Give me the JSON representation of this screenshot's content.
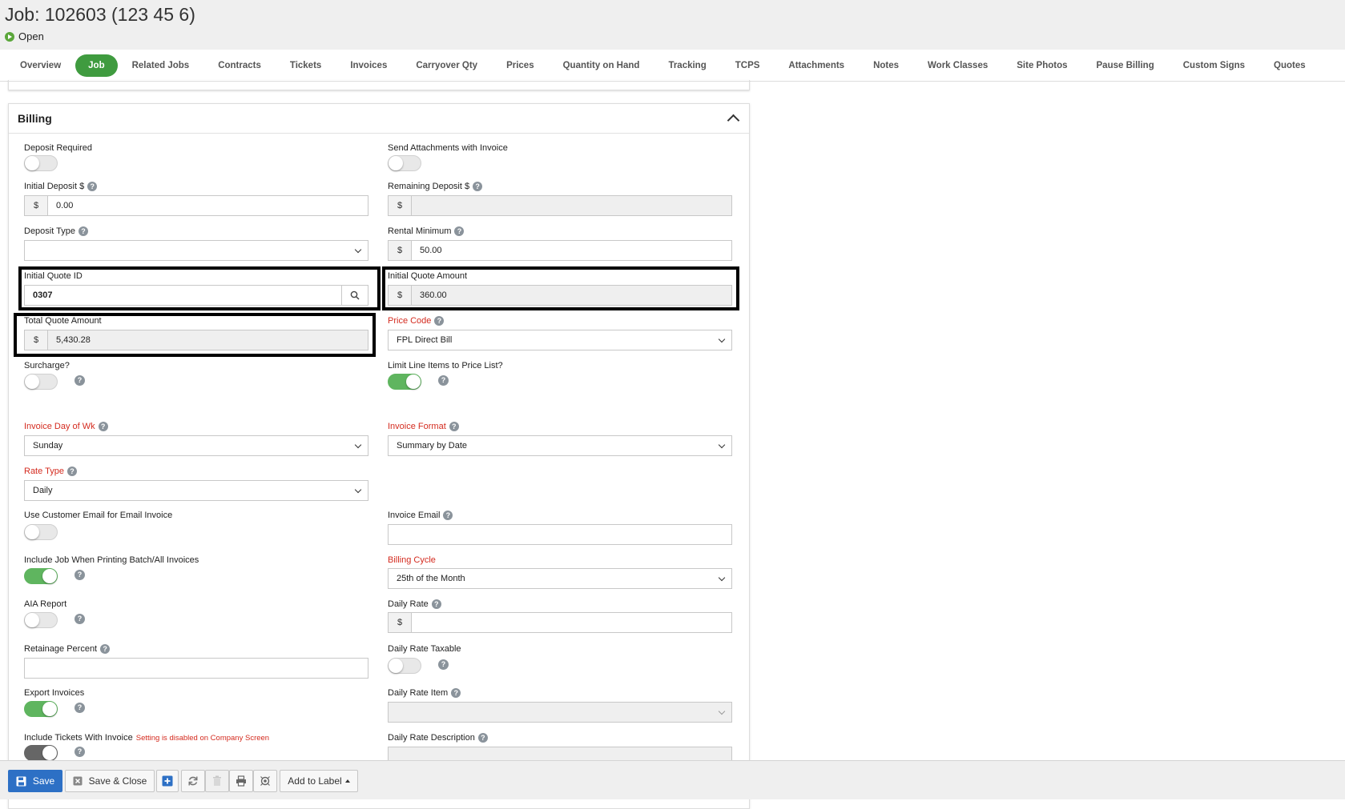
{
  "header": {
    "title": "Job: 102603 (123 45 6)",
    "status": "Open"
  },
  "tabs": [
    {
      "label": "Overview"
    },
    {
      "label": "Job"
    },
    {
      "label": "Related Jobs"
    },
    {
      "label": "Contracts"
    },
    {
      "label": "Tickets"
    },
    {
      "label": "Invoices"
    },
    {
      "label": "Carryover Qty"
    },
    {
      "label": "Prices"
    },
    {
      "label": "Quantity on Hand"
    },
    {
      "label": "Tracking"
    },
    {
      "label": "TCPS"
    },
    {
      "label": "Attachments"
    },
    {
      "label": "Notes"
    },
    {
      "label": "Work Classes"
    },
    {
      "label": "Site Photos"
    },
    {
      "label": "Pause Billing"
    },
    {
      "label": "Custom Signs"
    },
    {
      "label": "Quotes"
    }
  ],
  "active_tab": "Job",
  "billing": {
    "title": "Billing",
    "currency": "$",
    "help": "?",
    "deposit_required": {
      "label": "Deposit Required",
      "on": false
    },
    "send_attachments": {
      "label": "Send Attachments with Invoice",
      "on": false
    },
    "initial_deposit": {
      "label": "Initial Deposit $",
      "value": "0.00"
    },
    "remaining_deposit": {
      "label": "Remaining Deposit $",
      "value": ""
    },
    "deposit_type": {
      "label": "Deposit Type",
      "value": ""
    },
    "rental_minimum": {
      "label": "Rental Minimum",
      "value": "50.00"
    },
    "initial_quote_id": {
      "label": "Initial Quote ID",
      "value": "0307"
    },
    "initial_quote_amount": {
      "label": "Initial Quote Amount",
      "value": "360.00"
    },
    "total_quote_amount": {
      "label": "Total Quote Amount",
      "value": "5,430.28"
    },
    "price_code": {
      "label": "Price Code",
      "value": "FPL Direct Bill"
    },
    "surcharge": {
      "label": "Surcharge?",
      "on": false
    },
    "limit_line_items": {
      "label": "Limit Line Items to Price List?",
      "on": true
    },
    "invoice_day": {
      "label": "Invoice Day of Wk",
      "value": "Sunday"
    },
    "invoice_format": {
      "label": "Invoice Format",
      "value": "Summary by Date"
    },
    "rate_type": {
      "label": "Rate Type",
      "value": "Daily"
    },
    "use_customer_email": {
      "label": "Use Customer Email for Email Invoice",
      "on": false
    },
    "invoice_email": {
      "label": "Invoice Email",
      "value": ""
    },
    "include_job_printing": {
      "label": "Include Job When Printing Batch/All Invoices",
      "on": true
    },
    "billing_cycle": {
      "label": "Billing Cycle",
      "value": "25th of the Month"
    },
    "aia_report": {
      "label": "AIA Report",
      "on": false
    },
    "daily_rate": {
      "label": "Daily Rate",
      "value": ""
    },
    "retainage_percent": {
      "label": "Retainage Percent",
      "value": ""
    },
    "daily_rate_taxable": {
      "label": "Daily Rate Taxable",
      "on": false
    },
    "export_invoices": {
      "label": "Export Invoices",
      "on": true
    },
    "daily_rate_item": {
      "label": "Daily Rate Item",
      "value": ""
    },
    "include_tickets": {
      "label": "Include Tickets With Invoice",
      "note": "Setting is disabled on Company Screen",
      "on": true
    },
    "daily_rate_description": {
      "label": "Daily Rate Description",
      "value": ""
    }
  },
  "footer": {
    "save": "Save",
    "save_close": "Save & Close",
    "add_to_label": "Add to Label"
  },
  "colors": {
    "accent_green": "#3f9b3f",
    "primary_blue": "#2d70c5",
    "required_red": "#d42b1f",
    "highlight": "#000000"
  }
}
